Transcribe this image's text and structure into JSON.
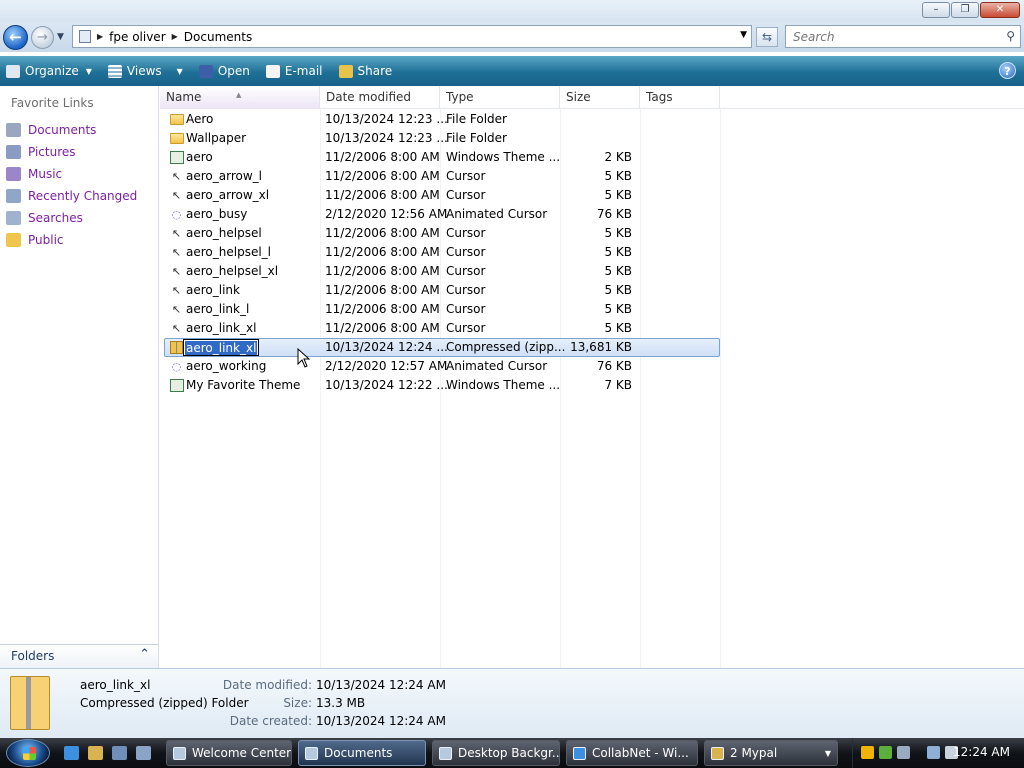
{
  "window": {
    "min_label": "–",
    "max_label": "❐",
    "close_label": "✕"
  },
  "address": {
    "back_icon": "←",
    "forward_icon": "→",
    "crumbs": [
      "fpe oliver",
      "Documents"
    ],
    "search_placeholder": "Search"
  },
  "toolbar": {
    "organize": "Organize",
    "views": "Views",
    "open": "Open",
    "email": "E-mail",
    "share": "Share",
    "help": "?"
  },
  "nav": {
    "header": "Favorite Links",
    "items": [
      "Documents",
      "Pictures",
      "Music",
      "Recently Changed",
      "Searches",
      "Public"
    ],
    "folders_label": "Folders"
  },
  "columns": [
    "Name",
    "Date modified",
    "Type",
    "Size",
    "Tags"
  ],
  "files": [
    {
      "name": "Aero",
      "date": "10/13/2024 12:23 ...",
      "type": "File Folder",
      "size": "",
      "icon": "folder"
    },
    {
      "name": "Wallpaper",
      "date": "10/13/2024 12:23 ...",
      "type": "File Folder",
      "size": "",
      "icon": "folder"
    },
    {
      "name": "aero",
      "date": "11/2/2006 8:00 AM",
      "type": "Windows Theme ...",
      "size": "2 KB",
      "icon": "theme"
    },
    {
      "name": "aero_arrow_l",
      "date": "11/2/2006 8:00 AM",
      "type": "Cursor",
      "size": "5 KB",
      "icon": "cursor"
    },
    {
      "name": "aero_arrow_xl",
      "date": "11/2/2006 8:00 AM",
      "type": "Cursor",
      "size": "5 KB",
      "icon": "cursor"
    },
    {
      "name": "aero_busy",
      "date": "2/12/2020 12:56 AM",
      "type": "Animated Cursor",
      "size": "76 KB",
      "icon": "animated"
    },
    {
      "name": "aero_helpsel",
      "date": "11/2/2006 8:00 AM",
      "type": "Cursor",
      "size": "5 KB",
      "icon": "cursor"
    },
    {
      "name": "aero_helpsel_l",
      "date": "11/2/2006 8:00 AM",
      "type": "Cursor",
      "size": "5 KB",
      "icon": "cursor"
    },
    {
      "name": "aero_helpsel_xl",
      "date": "11/2/2006 8:00 AM",
      "type": "Cursor",
      "size": "5 KB",
      "icon": "cursor"
    },
    {
      "name": "aero_link",
      "date": "11/2/2006 8:00 AM",
      "type": "Cursor",
      "size": "5 KB",
      "icon": "cursor"
    },
    {
      "name": "aero_link_l",
      "date": "11/2/2006 8:00 AM",
      "type": "Cursor",
      "size": "5 KB",
      "icon": "cursor"
    },
    {
      "name": "aero_link_xl",
      "date": "11/2/2006 8:00 AM",
      "type": "Cursor",
      "size": "5 KB",
      "icon": "cursor"
    },
    {
      "name": "aero_link_xl",
      "date": "10/13/2024 12:24 ...",
      "type": "Compressed (zipp...",
      "size": "13,681 KB",
      "icon": "zip",
      "selected": true,
      "renaming": true
    },
    {
      "name": "aero_working",
      "date": "2/12/2020 12:57 AM",
      "type": "Animated Cursor",
      "size": "76 KB",
      "icon": "animated"
    },
    {
      "name": "My Favorite Theme",
      "date": "10/13/2024 12:22 ...",
      "type": "Windows Theme ...",
      "size": "7 KB",
      "icon": "theme"
    }
  ],
  "details": {
    "name": "aero_link_xl",
    "type": "Compressed (zipped) Folder",
    "date_modified_label": "Date modified:",
    "date_modified": "10/13/2024 12:24 AM",
    "size_label": "Size:",
    "size": "13.3 MB",
    "date_created_label": "Date created:",
    "date_created": "10/13/2024 12:24 AM"
  },
  "taskbar": {
    "tasks": [
      {
        "label": "Welcome Center",
        "active": false
      },
      {
        "label": "Documents",
        "active": true
      },
      {
        "label": "Desktop Backgr...",
        "active": false
      },
      {
        "label": "CollabNet - Wi...",
        "active": false
      },
      {
        "label": "2 Mypal",
        "active": false
      }
    ],
    "clock": "12:24 AM"
  },
  "colors": {
    "toolbar": "#1f6f96",
    "link": "#7d1fa4",
    "selection": "#cfe0f6"
  }
}
